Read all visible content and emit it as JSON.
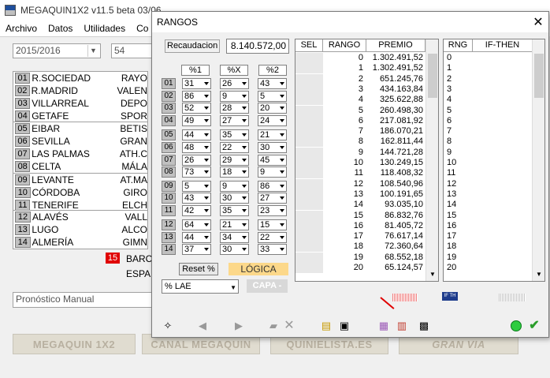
{
  "main": {
    "title": "MEGAQUIN1X2 v11.5 beta 03/06",
    "menu": [
      "Archivo",
      "Datos",
      "Utilidades",
      "Co"
    ],
    "season": "2015/2016",
    "jornada": "54",
    "teams_left": [
      "R.SOCIEDAD",
      "R.MADRID",
      "VILLARREAL",
      "GETAFE",
      "EIBAR",
      "SEVILLA",
      "LAS PALMAS",
      "CELTA",
      "LEVANTE",
      "CÓRDOBA",
      "TENERIFE",
      "ALAVÉS",
      "LUGO",
      "ALMERÍA"
    ],
    "teams_right": [
      "RAYO",
      "VALEN",
      "DEPO",
      "SPOR",
      "BETIS",
      "GRAN",
      "ATH.C",
      "MÁLA",
      "AT.MA",
      "GIRO",
      "ELCH",
      "VALL",
      "ALCO",
      "GIMN"
    ],
    "nums": [
      "01",
      "02",
      "03",
      "04",
      "05",
      "06",
      "07",
      "08",
      "09",
      "10",
      "11",
      "12",
      "13",
      "14"
    ],
    "row15": {
      "num": "15",
      "home": "BARC",
      "away": "ESPA"
    },
    "pronostico": "Pronóstico Manual",
    "brands": [
      "MEGAQUIN 1X2",
      "CANAL MEGAQUIN",
      "QUINIELISTA.ES",
      "GRAN VIA"
    ]
  },
  "dialog": {
    "title": "RANGOS",
    "recaudacion_label": "Recaudacion",
    "recaudacion_value": "8.140.572,00",
    "pct_headers": [
      "%1",
      "%X",
      "%2"
    ],
    "rows": [
      [
        "01",
        "31",
        "26",
        "43"
      ],
      [
        "02",
        "86",
        "9",
        "5"
      ],
      [
        "03",
        "52",
        "28",
        "20"
      ],
      [
        "04",
        "49",
        "27",
        "24"
      ],
      [
        "05",
        "44",
        "35",
        "21"
      ],
      [
        "06",
        "48",
        "22",
        "30"
      ],
      [
        "07",
        "26",
        "29",
        "45"
      ],
      [
        "08",
        "73",
        "18",
        "9"
      ],
      [
        "09",
        "5",
        "9",
        "86"
      ],
      [
        "10",
        "43",
        "30",
        "27"
      ],
      [
        "11",
        "42",
        "35",
        "23"
      ],
      [
        "12",
        "64",
        "21",
        "15"
      ],
      [
        "13",
        "44",
        "34",
        "22"
      ],
      [
        "14",
        "37",
        "30",
        "33"
      ]
    ],
    "reset_label": "Reset %",
    "logica_label": "LÓGICA",
    "lae_value": "% LAE",
    "capa_label": "CAPA -",
    "grid1_headers": [
      "SEL",
      "RANGO",
      "PREMIO"
    ],
    "rangos": [
      "0",
      "1",
      "2",
      "3",
      "4",
      "5",
      "6",
      "7",
      "8",
      "9",
      "10",
      "11",
      "12",
      "13",
      "14",
      "15",
      "16",
      "17",
      "18",
      "19",
      "20"
    ],
    "premios": [
      "1.302.491,52",
      "1.302.491,52",
      "651.245,76",
      "434.163,84",
      "325.622,88",
      "260.498,30",
      "217.081,92",
      "186.070,21",
      "162.811,44",
      "144.721,28",
      "130.249,15",
      "118.408,32",
      "108.540,96",
      "100.191,65",
      "93.035,10",
      "86.832,76",
      "81.405,72",
      "76.617,14",
      "72.360,64",
      "68.552,18",
      "65.124,57"
    ],
    "grid2_headers": [
      "RNG",
      "IF-THEN"
    ],
    "ifthen_badge": "IF TH",
    "colors": {
      "logica_bg": "#fcd88a",
      "capa_bg": "#d8d8d8",
      "grid_shade": "#e8e8e8",
      "red_badge": "#e00000"
    }
  }
}
